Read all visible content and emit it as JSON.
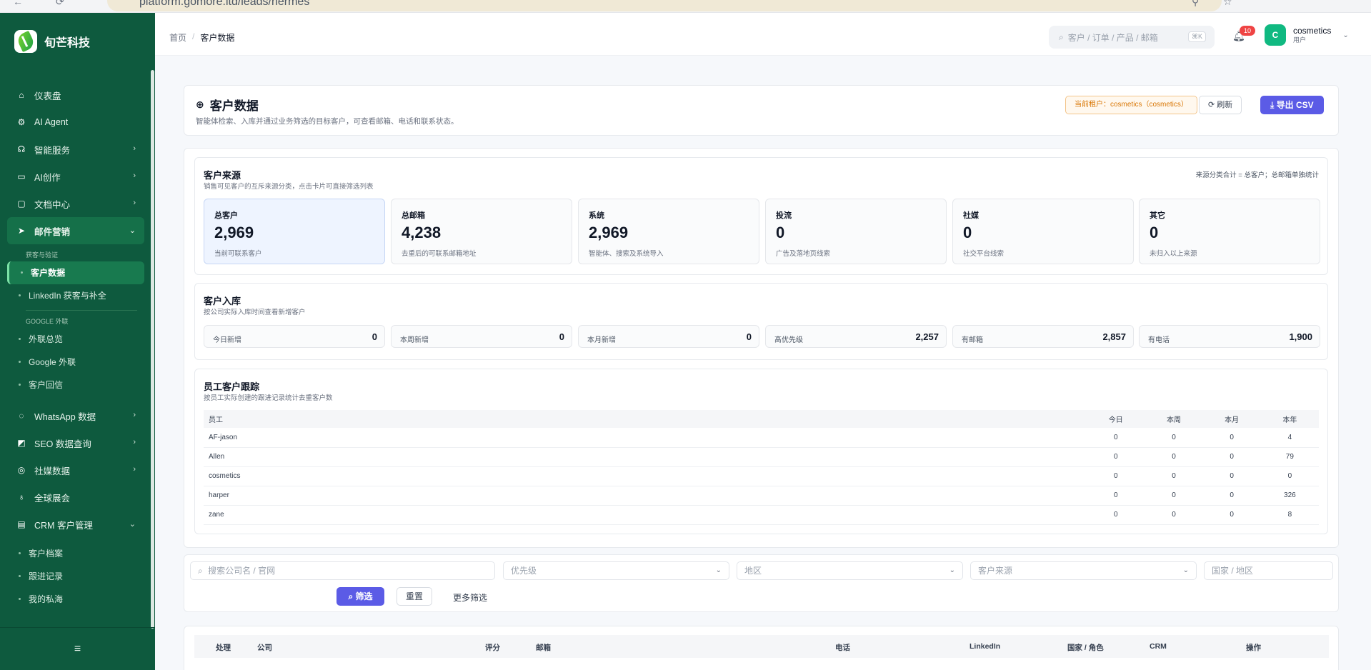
{
  "browser": {
    "url": "platform.gomore.ltd/leads/hermes"
  },
  "brand": {
    "name": "旬芒科技"
  },
  "sidebar": {
    "items": [
      {
        "label": "仪表盘",
        "icon": "home-icon"
      },
      {
        "label": "AI Agent",
        "icon": "chip-icon"
      },
      {
        "label": "智能服务",
        "icon": "headset-icon"
      },
      {
        "label": "AI创作",
        "icon": "video-icon"
      },
      {
        "label": "文档中心",
        "icon": "folder-icon"
      },
      {
        "label": "邮件营销",
        "icon": "send-icon"
      }
    ],
    "mail_group1": "获客与验证",
    "mail_sub1": [
      "客户数据",
      "LinkedIn 获客与补全"
    ],
    "mail_group2": "GOOGLE 外联",
    "mail_sub2": [
      "外联总览",
      "Google 外联",
      "客户回信"
    ],
    "items2": [
      {
        "label": "WhatsApp 数据",
        "icon": "chat-icon"
      },
      {
        "label": "SEO 数据查询",
        "icon": "chart-icon"
      },
      {
        "label": "社媒数据",
        "icon": "share-icon"
      },
      {
        "label": "全球展会",
        "icon": "globe-user-icon"
      },
      {
        "label": "CRM 客户管理",
        "icon": "crm-icon"
      }
    ],
    "crm_sub": [
      "客户档案",
      "跟进记录",
      "我的私海"
    ],
    "collapse": "≡"
  },
  "header": {
    "crumb_home": "首页",
    "crumb_sep": "/",
    "crumb_current": "客户数据",
    "search_placeholder": "客户 / 订单 / 产品 / 邮箱",
    "search_kbd": "⌘K",
    "notify_count": "10",
    "user_initial": "C",
    "user_name": "cosmetics",
    "user_role": "用户"
  },
  "page": {
    "title": "客户数据",
    "desc": "智能体检索、入库并通过业务筛选的目标客户，可查看邮箱、电话和联系状态。",
    "tenant": "当前租户：cosmetics（cosmetics）",
    "refresh": "刷新",
    "export": "导出 CSV"
  },
  "source": {
    "title": "客户来源",
    "desc": "销售可见客户的互斥来源分类，点击卡片可直接筛选列表",
    "note": "来源分类合计 = 总客户；总邮箱单独统计",
    "cards": [
      {
        "label": "总客户",
        "value": "2,969",
        "note": "当前可联系客户"
      },
      {
        "label": "总邮箱",
        "value": "4,238",
        "note": "去重后的可联系邮箱地址"
      },
      {
        "label": "系统",
        "value": "2,969",
        "note": "智能体、搜索及系统导入"
      },
      {
        "label": "投流",
        "value": "0",
        "note": "广告及落地页线索"
      },
      {
        "label": "社媒",
        "value": "0",
        "note": "社交平台线索"
      },
      {
        "label": "其它",
        "value": "0",
        "note": "未归入以上来源"
      }
    ]
  },
  "inbound": {
    "title": "客户入库",
    "desc": "按公司实际入库时间查看新增客户",
    "stats": [
      {
        "label": "今日新增",
        "value": "0"
      },
      {
        "label": "本周新增",
        "value": "0"
      },
      {
        "label": "本月新增",
        "value": "0"
      },
      {
        "label": "高优先级",
        "value": "2,257"
      },
      {
        "label": "有邮箱",
        "value": "2,857"
      },
      {
        "label": "有电话",
        "value": "1,900"
      }
    ]
  },
  "staff": {
    "title": "员工客户跟踪",
    "desc": "按员工实际创建的跟进记录统计去重客户数",
    "columns": [
      "员工",
      "今日",
      "本周",
      "本月",
      "本年"
    ],
    "rows": [
      [
        "AF-jason",
        "0",
        "0",
        "0",
        "4"
      ],
      [
        "Allen",
        "0",
        "0",
        "0",
        "79"
      ],
      [
        "cosmetics",
        "0",
        "0",
        "0",
        "0"
      ],
      [
        "harper",
        "0",
        "0",
        "0",
        "326"
      ],
      [
        "zane",
        "0",
        "0",
        "0",
        "8"
      ]
    ]
  },
  "filters": {
    "search_placeholder": "搜索公司名 / 官网",
    "priority": "优先级",
    "region": "地区",
    "source": "客户来源",
    "country": "国家 / 地区",
    "filter_btn": "筛选",
    "reset_btn": "重置",
    "more": "更多筛选"
  },
  "table": {
    "columns": [
      "处理",
      "公司",
      "评分",
      "邮箱",
      "电话",
      "LinkedIn",
      "国家 / 角色",
      "CRM",
      "操作"
    ]
  }
}
